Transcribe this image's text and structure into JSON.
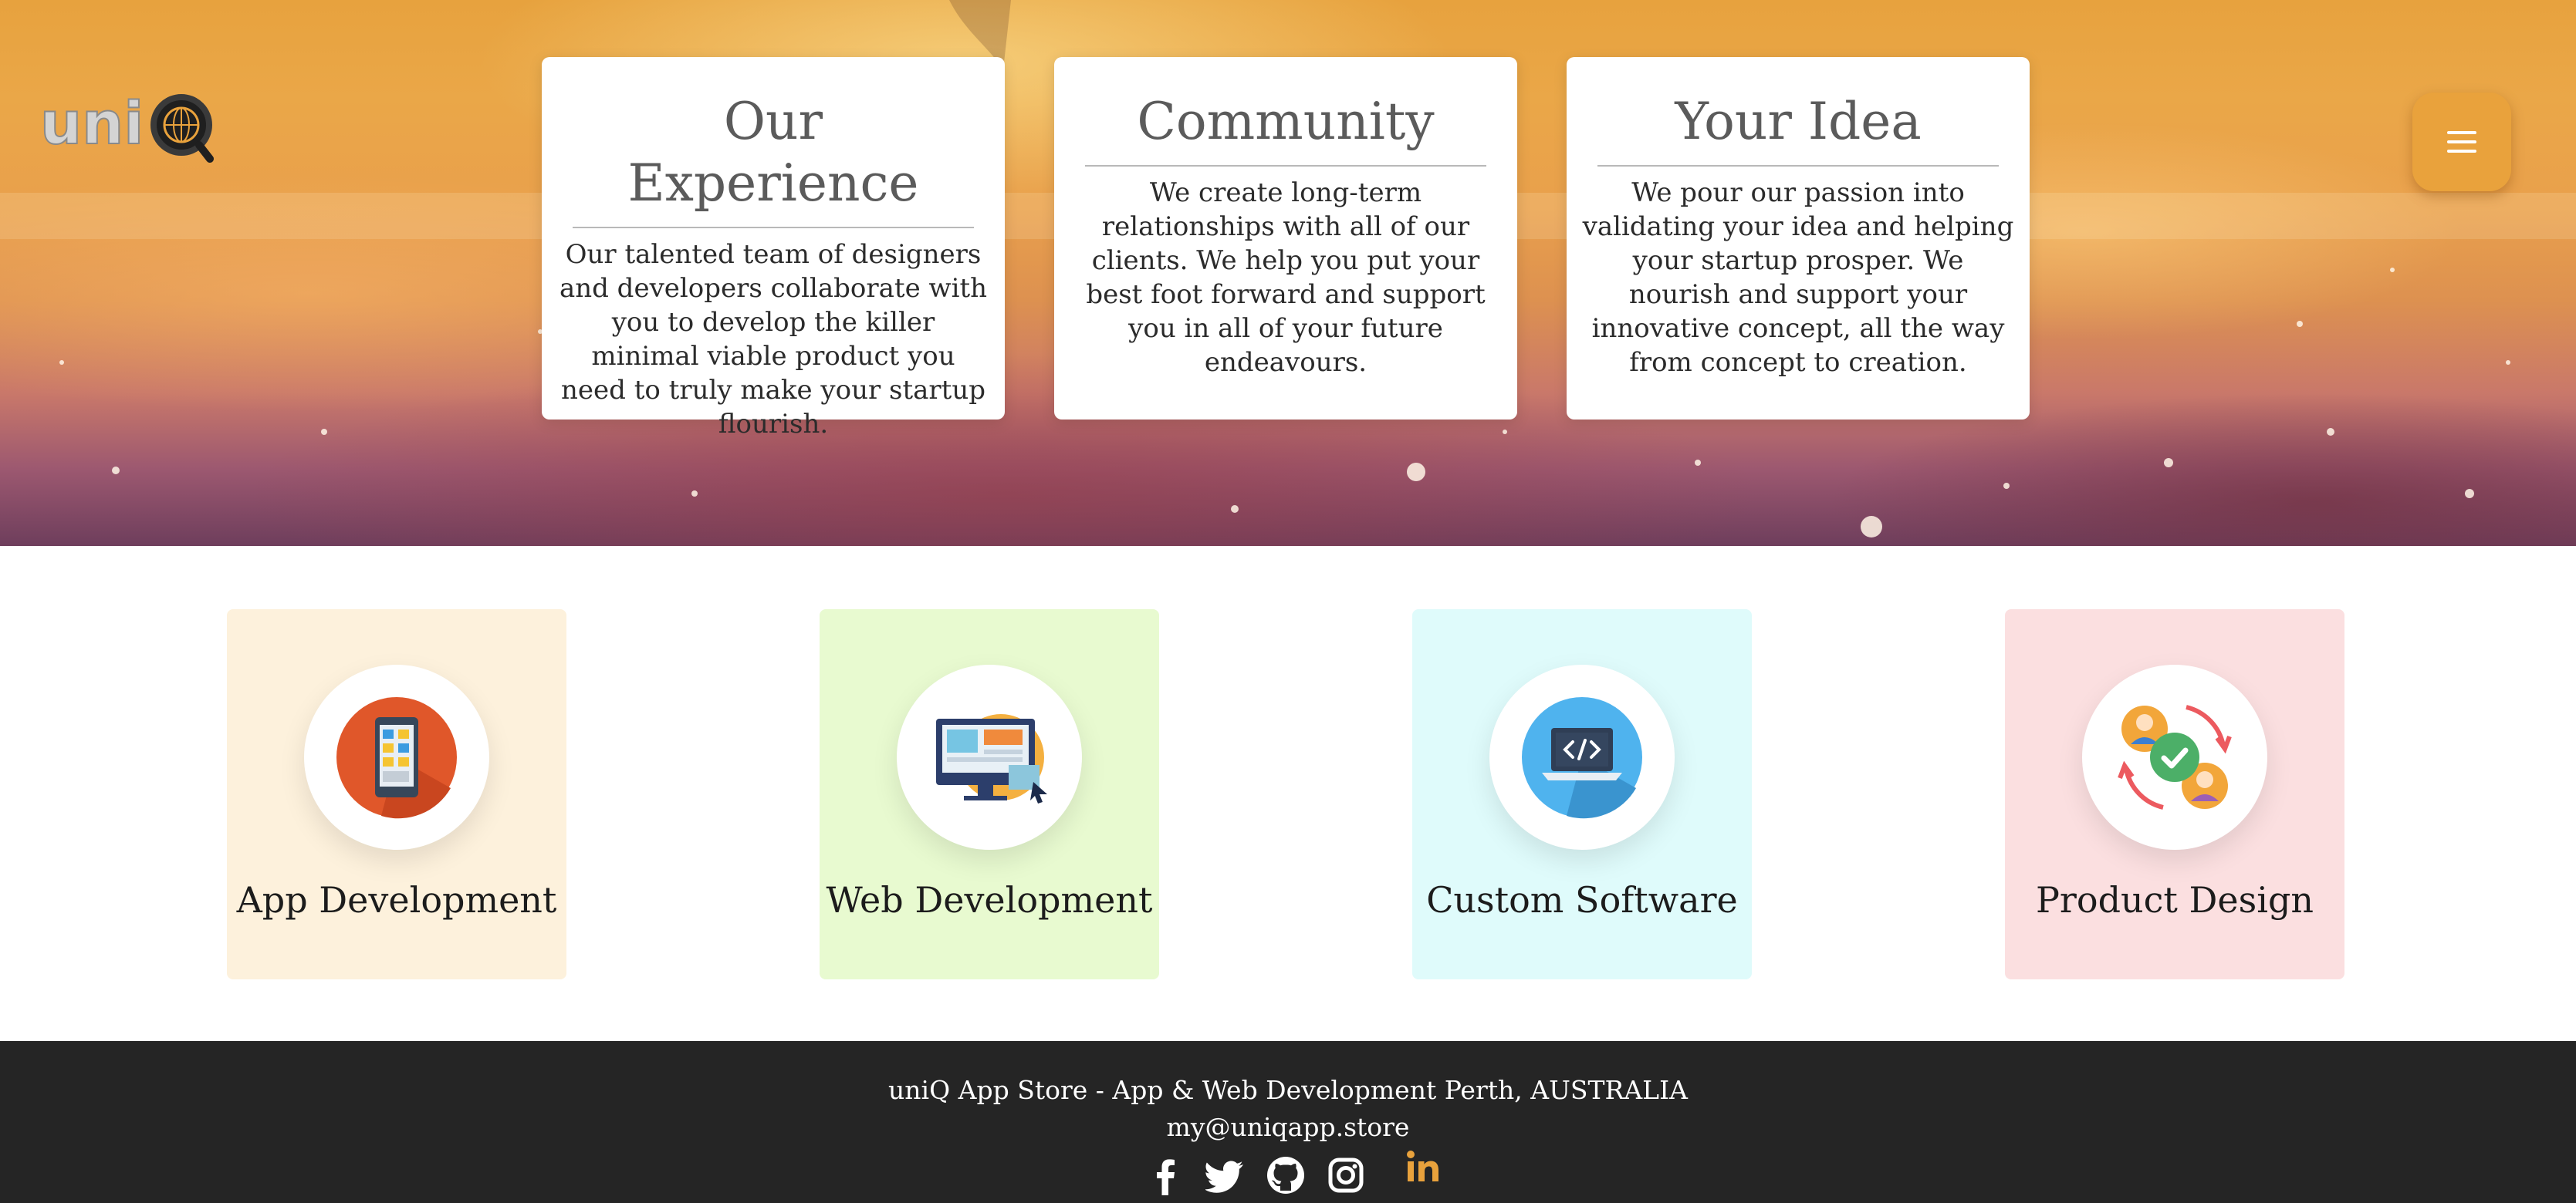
{
  "brand": {
    "name": "uniQ"
  },
  "menu": {
    "icon": "hamburger-menu-icon"
  },
  "cards": [
    {
      "title": "Our Experience",
      "text": "Our talented team of designers and developers collaborate with you to develop the killer minimal viable product you need to truly make your startup flourish."
    },
    {
      "title": "Community",
      "text": "We create long-term relationships with all of our clients. We help you put your best foot forward and support you in all of your future endeavours."
    },
    {
      "title": "Your Idea",
      "text": "We pour our passion into validating your idea and helping your startup prosper. We nourish and support your innovative concept, all the way from concept to creation."
    }
  ],
  "services": [
    {
      "label": "App Development",
      "icon": "mobile-app-icon",
      "bg": "#fdf1dc"
    },
    {
      "label": "Web Development",
      "icon": "web-monitor-icon",
      "bg": "#e8fad0"
    },
    {
      "label": "Custom Software",
      "icon": "laptop-code-icon",
      "bg": "#dffbfb"
    },
    {
      "label": "Product Design",
      "icon": "user-exchange-icon",
      "bg": "#fbdfe0"
    }
  ],
  "footer": {
    "line1": "uniQ App Store - App & Web Development Perth, AUSTRALIA",
    "email": "my@uniqapp.store",
    "socials": [
      "facebook-icon",
      "twitter-icon",
      "github-icon",
      "instagram-icon",
      "linkedin-icon"
    ]
  },
  "colors": {
    "accent": "#e9a23c",
    "footer_bg": "#252525",
    "linkedin": "#e9a23c"
  }
}
